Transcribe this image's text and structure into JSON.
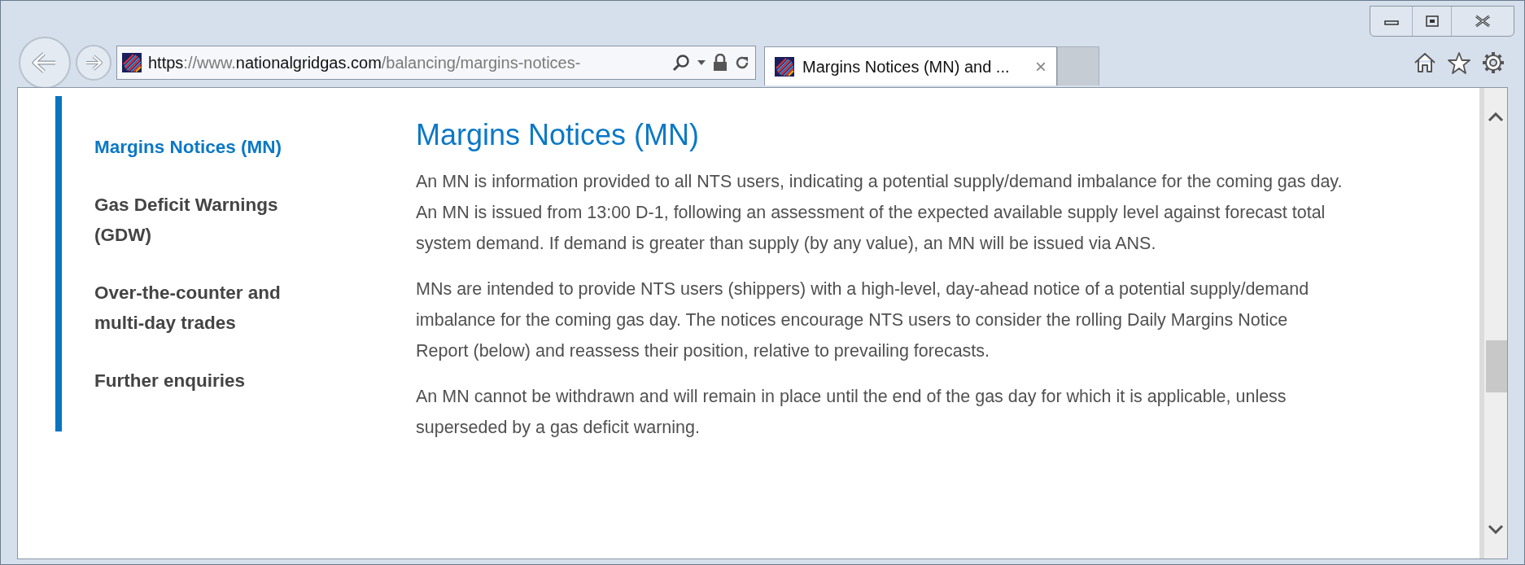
{
  "address_bar": {
    "url_parts": [
      {
        "text": "https",
        "strong": true
      },
      {
        "text": "://www.",
        "strong": false
      },
      {
        "text": "nationalgridgas.com",
        "strong": true
      },
      {
        "text": "/balancing/margins-notices-",
        "strong": false
      }
    ]
  },
  "tabs": [
    {
      "title": "Margins Notices (MN) and ...",
      "selected": true,
      "close": "×"
    }
  ],
  "sidebar": {
    "items": [
      {
        "label": "Margins Notices (MN)",
        "selected": true
      },
      {
        "label": "Gas Deficit Warnings (GDW)",
        "selected": false
      },
      {
        "label": "Over-the-counter and multi-day trades",
        "selected": false
      },
      {
        "label": "Further enquiries",
        "selected": false
      }
    ]
  },
  "article": {
    "heading": "Margins Notices (MN)",
    "paragraphs": [
      "An MN is information provided to all NTS users, indicating a potential supply/demand imbalance for the coming gas day. An MN is issued from 13:00 D-1, following an assessment of the expected available supply level against forecast total system demand. If demand is greater than supply (by any value), an MN will be issued via ANS.",
      "MNs are intended to provide NTS users (shippers) with a high-level, day-ahead notice of a potential supply/demand imbalance for the coming gas day. The notices encourage NTS users to consider the rolling Daily Margins Notice Report (below) and reassess their position, relative to prevailing forecasts.",
      "An MN cannot be withdrawn and will remain in place until the end of the gas day for which it is applicable, unless superseded by a gas deficit warning."
    ]
  }
}
